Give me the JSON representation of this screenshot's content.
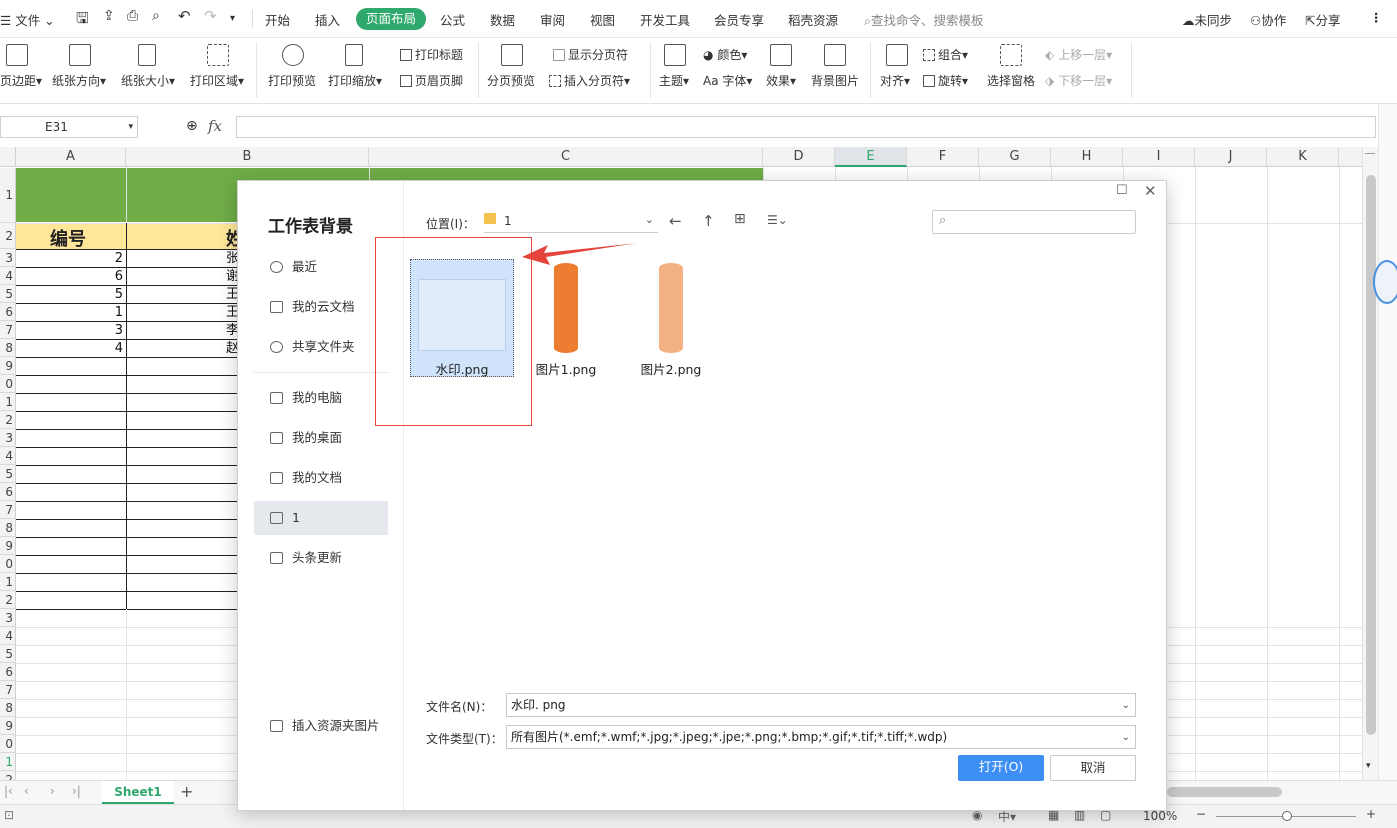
{
  "menubar": {
    "file_menu": "文件",
    "tabs": [
      "开始",
      "插入",
      "页面布局",
      "公式",
      "数据",
      "审阅",
      "视图",
      "开发工具",
      "会员专享",
      "稻壳资源"
    ],
    "active_tab": "页面布局",
    "search_placeholder": "查找命令、搜索模板",
    "sync": "未同步",
    "collab": "协作",
    "share": "分享"
  },
  "ribbon": {
    "margins": "页边距",
    "orientation": "纸张方向",
    "size": "纸张大小",
    "print_area": "打印区域",
    "print_preview": "打印预览",
    "print_scale": "打印缩放",
    "print_titles": "打印标题",
    "header_footer": "页眉页脚",
    "page_break_preview": "分页预览",
    "show_page_breaks": "显示分页符",
    "insert_page_break": "插入分页符",
    "theme": "主题",
    "colors": "颜色",
    "fonts": "字体",
    "fonts_prefix": "Aa",
    "effects": "效果",
    "background_image": "背景图片",
    "align": "对齐",
    "group": "组合",
    "rotate": "旋转",
    "selection_pane": "选择窗格",
    "bring_forward": "上移一层",
    "send_backward": "下移一层"
  },
  "formula_bar": {
    "name_box": "E31",
    "fx": "fx"
  },
  "grid": {
    "columns": [
      "A",
      "B",
      "C",
      "D",
      "E",
      "F",
      "G",
      "H",
      "I",
      "J",
      "K"
    ],
    "selected_column": "E",
    "row_numbers": [
      "1",
      "2",
      "3",
      "4",
      "5",
      "6",
      "7",
      "8",
      "9",
      "0",
      "1",
      "2",
      "3",
      "4",
      "5",
      "6",
      "7",
      "8",
      "9",
      "0",
      "1",
      "2",
      "3",
      "4",
      "5",
      "6",
      "7",
      "8",
      "9",
      "0",
      "1",
      "2"
    ],
    "header_row": [
      "编号",
      "姓"
    ],
    "col_a_values": [
      "2",
      "6",
      "5",
      "1",
      "3",
      "4"
    ],
    "col_b_partial": [
      "张",
      "谢",
      "王",
      "王",
      "李",
      "赵"
    ],
    "title_bar_color": "#70ad47",
    "header_fill_color": "#ffe699"
  },
  "sheetbar": {
    "sheet_name": "Sheet1",
    "add": "+"
  },
  "statusbar": {
    "zoom": "100%"
  },
  "dialog": {
    "title": "工作表背景",
    "location_label": "位置(I)：",
    "location_value": "1",
    "sidebar": [
      "最近",
      "我的云文档",
      "共享文件夹",
      "我的电脑",
      "我的桌面",
      "我的文档",
      "1",
      "头条更新"
    ],
    "active_sidebar": "1",
    "insert_resource": "插入资源夹图片",
    "files": [
      {
        "name": "水印.png",
        "selected": true,
        "color": "#dbe9fb"
      },
      {
        "name": "图片1.png",
        "selected": false,
        "color": "#ed7d31"
      },
      {
        "name": "图片2.png",
        "selected": false,
        "color": "#f4b183"
      }
    ],
    "filename_label": "文件名(N)：",
    "filename_value": "水印. png",
    "filetype_label": "文件类型(T)：",
    "filetype_value": "所有图片(*.emf;*.wmf;*.jpg;*.jpeg;*.jpe;*.png;*.bmp;*.gif;*.tif;*.tiff;*.wdp)",
    "open_button": "打开(O)",
    "cancel_button": "取消",
    "accent": "#3d8ef5"
  }
}
